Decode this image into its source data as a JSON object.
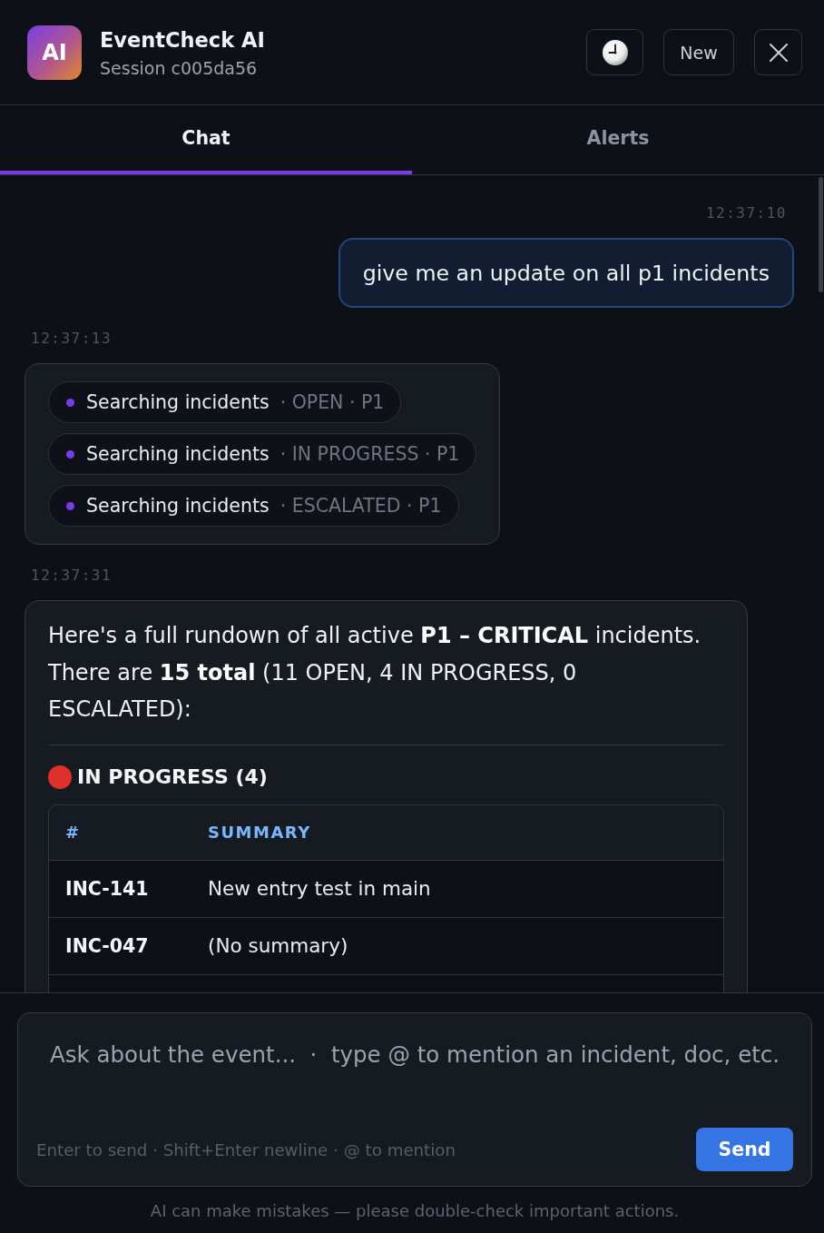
{
  "header": {
    "logo": "AI",
    "title": "EventCheck AI",
    "subtitle": "Session c005da56",
    "actions": [
      {
        "kind": "history"
      },
      {
        "kind": "text",
        "label": "New"
      },
      {
        "kind": "close"
      }
    ]
  },
  "tabs": [
    {
      "label": "Chat",
      "selected": true
    },
    {
      "label": "Alerts",
      "selected": false
    }
  ],
  "messages": [
    {
      "kind": "user",
      "time": "12:37:10",
      "text": "give me an update on all p1 incidents"
    },
    {
      "kind": "tool",
      "time": "12:37:13",
      "steps": [
        {
          "label": "Searching incidents",
          "detail": "· OPEN · P1"
        },
        {
          "label": "Searching incidents",
          "detail": "· IN PROGRESS · P1"
        },
        {
          "label": "Searching incidents",
          "detail": "· ESCALATED · P1"
        }
      ]
    },
    {
      "kind": "assistant",
      "time": "12:37:31",
      "text": "Here's a full rundown of all active **P1 – CRITICAL** incidents. There are **15 total** (11 OPEN, 4 IN PROGRESS, 0 ESCALATED):",
      "sections": [
        {
          "color": "#e0302b",
          "heading": "IN PROGRESS (4)",
          "table": {
            "columns": [
              "#",
              "SUMMARY"
            ],
            "rows": [
              [
                "INC-141",
                "New entry test in main"
              ],
              [
                "INC-047",
                "(No summary)"
              ]
            ]
          }
        }
      ]
    }
  ],
  "composer": {
    "placeholder": "Ask about the event...  ·  type @ to mention an incident, doc, etc.",
    "hint": "Enter to send · Shift+Enter newline · @ to mention",
    "send": "Send"
  },
  "disclaimer": "AI can make mistakes — please double-check important actions."
}
